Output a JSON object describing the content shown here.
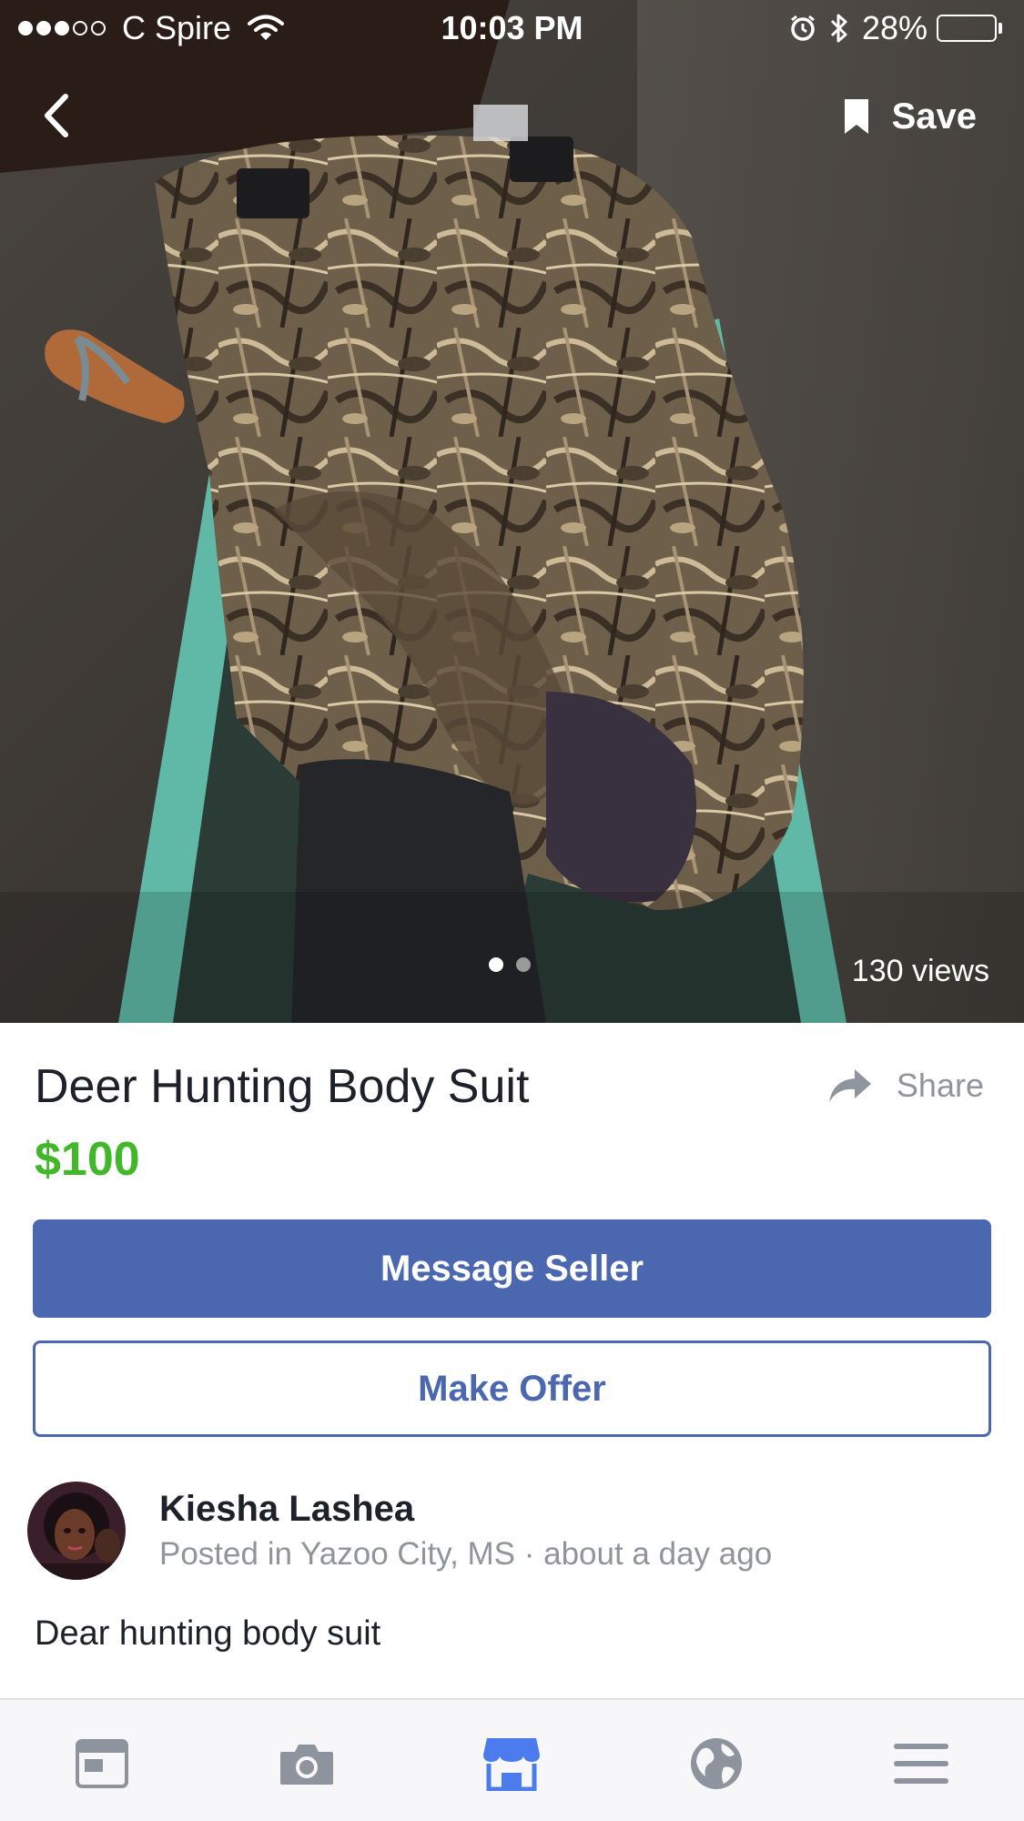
{
  "status_bar": {
    "carrier": "C Spire",
    "time": "10:03 PM",
    "battery": "28%",
    "battery_level": 0.28,
    "signal_bars_filled": 3,
    "signal_bars_total": 5
  },
  "nav": {
    "save_label": "Save"
  },
  "photo": {
    "views": "130 views",
    "page_count": 2,
    "current_page": 1
  },
  "listing": {
    "title": "Deer Hunting Body Suit",
    "price": "$100",
    "share_label": "Share",
    "message_button": "Message Seller",
    "offer_button": "Make Offer",
    "description": "Dear hunting body suit"
  },
  "seller": {
    "name": "Kiesha Lashea",
    "meta": "Posted in Yazoo City, MS · about a day ago"
  },
  "tabs": [
    {
      "icon": "news-feed-icon",
      "active": false
    },
    {
      "icon": "camera-icon",
      "active": false
    },
    {
      "icon": "marketplace-icon",
      "active": true
    },
    {
      "icon": "globe-icon",
      "active": false
    },
    {
      "icon": "menu-icon",
      "active": false
    }
  ],
  "colors": {
    "brand_blue": "#4b67b0",
    "price_green": "#42b72a",
    "muted_text": "#90949c",
    "tab_inactive": "#8d949e",
    "tab_active": "#4b7bec"
  }
}
